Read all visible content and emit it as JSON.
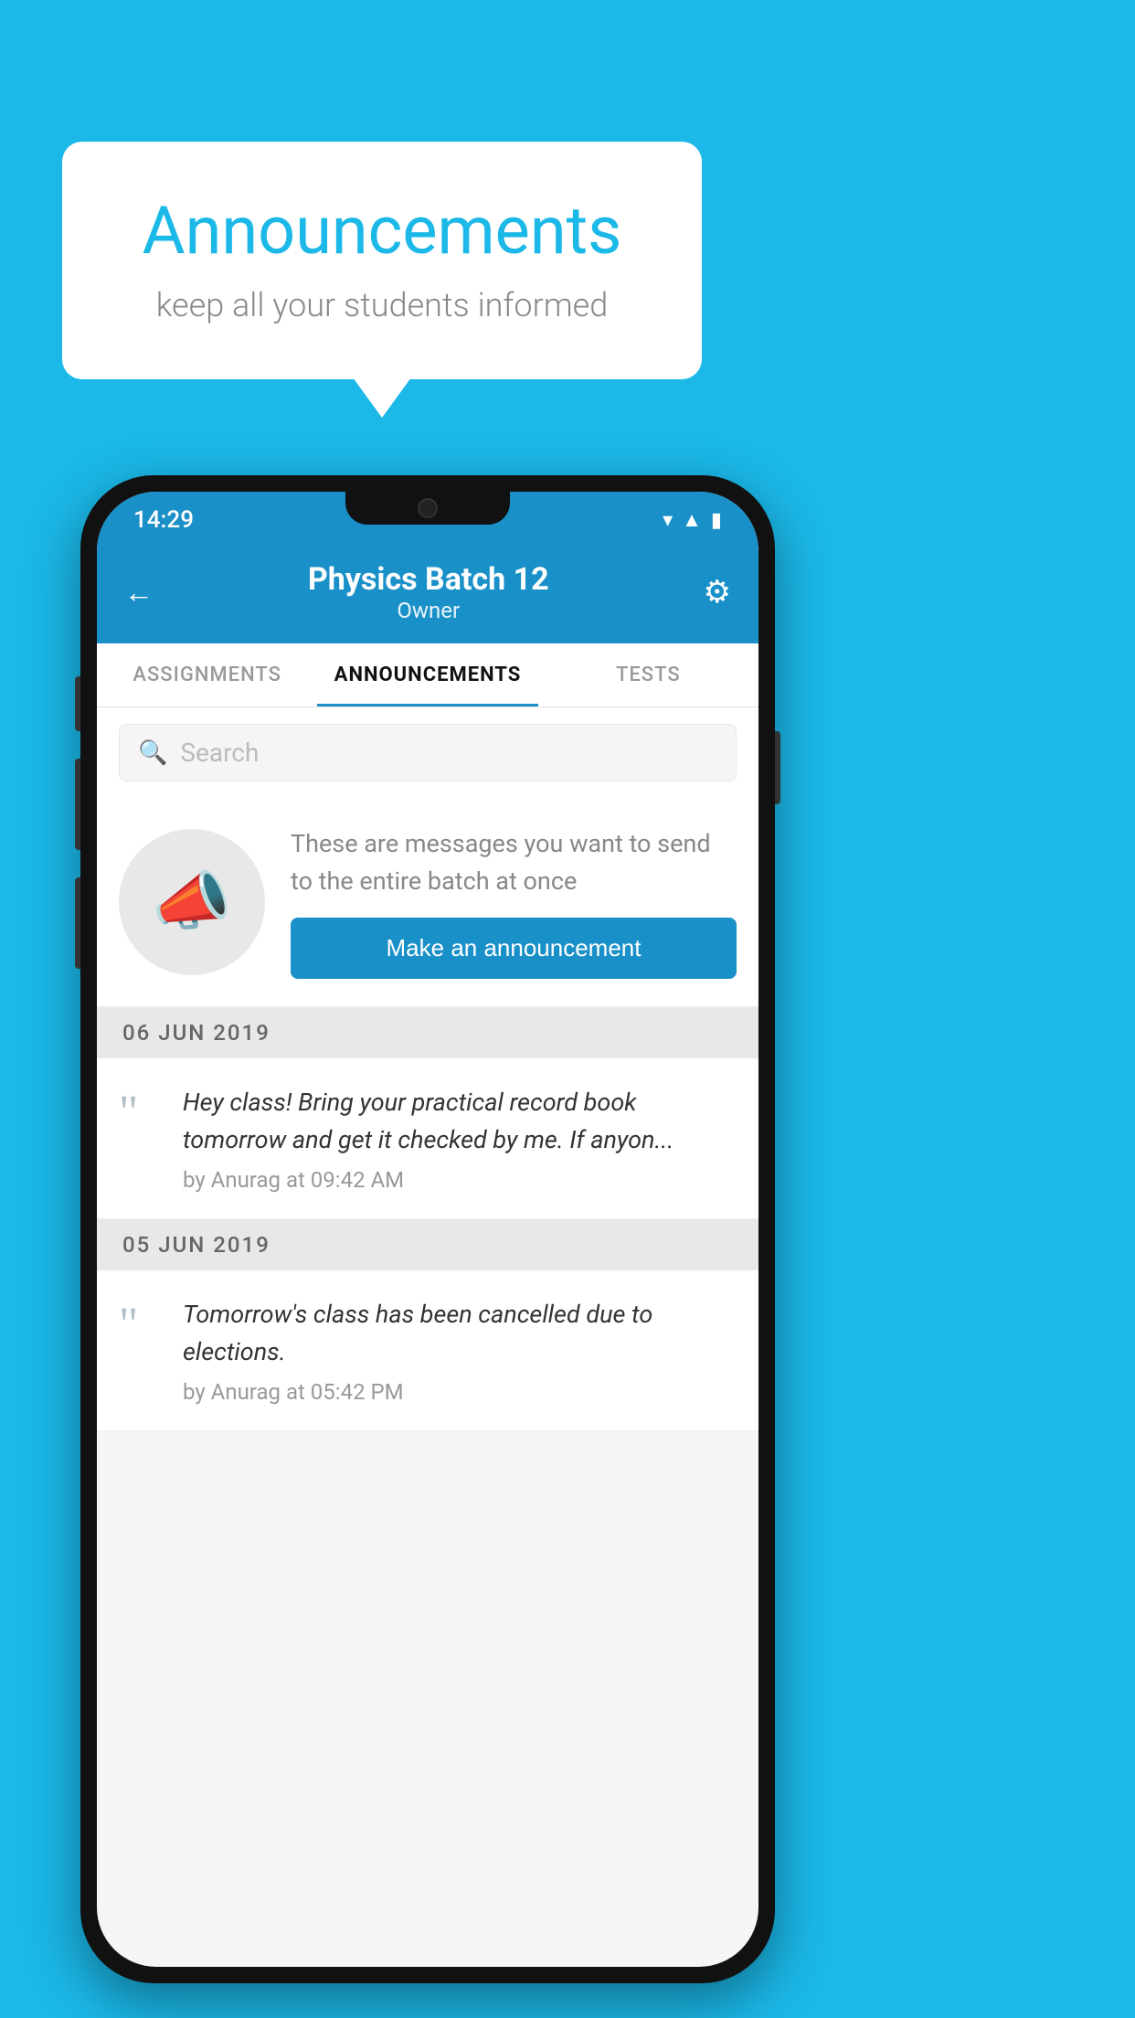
{
  "background_color": "#1BB8E8",
  "speech_bubble": {
    "title": "Announcements",
    "subtitle": "keep all your students informed"
  },
  "phone": {
    "status_bar": {
      "time": "14:29",
      "wifi": "▼▲",
      "signal": "▲",
      "battery": "▮"
    },
    "header": {
      "back_label": "←",
      "title": "Physics Batch 12",
      "subtitle": "Owner",
      "gear_label": "⚙"
    },
    "tabs": [
      {
        "label": "ASSIGNMENTS",
        "active": false
      },
      {
        "label": "ANNOUNCEMENTS",
        "active": true
      },
      {
        "label": "TESTS",
        "active": false
      }
    ],
    "search": {
      "placeholder": "Search"
    },
    "announcement_prompt": {
      "description_text": "These are messages you want to send to the entire batch at once",
      "button_label": "Make an announcement"
    },
    "announcements": [
      {
        "date": "06  JUN  2019",
        "text": "Hey class! Bring your practical record book tomorrow and get it checked by me. If anyon...",
        "meta": "by Anurag at 09:42 AM"
      },
      {
        "date": "05  JUN  2019",
        "text": "Tomorrow's class has been cancelled due to elections.",
        "meta": "by Anurag at 05:42 PM"
      }
    ]
  }
}
